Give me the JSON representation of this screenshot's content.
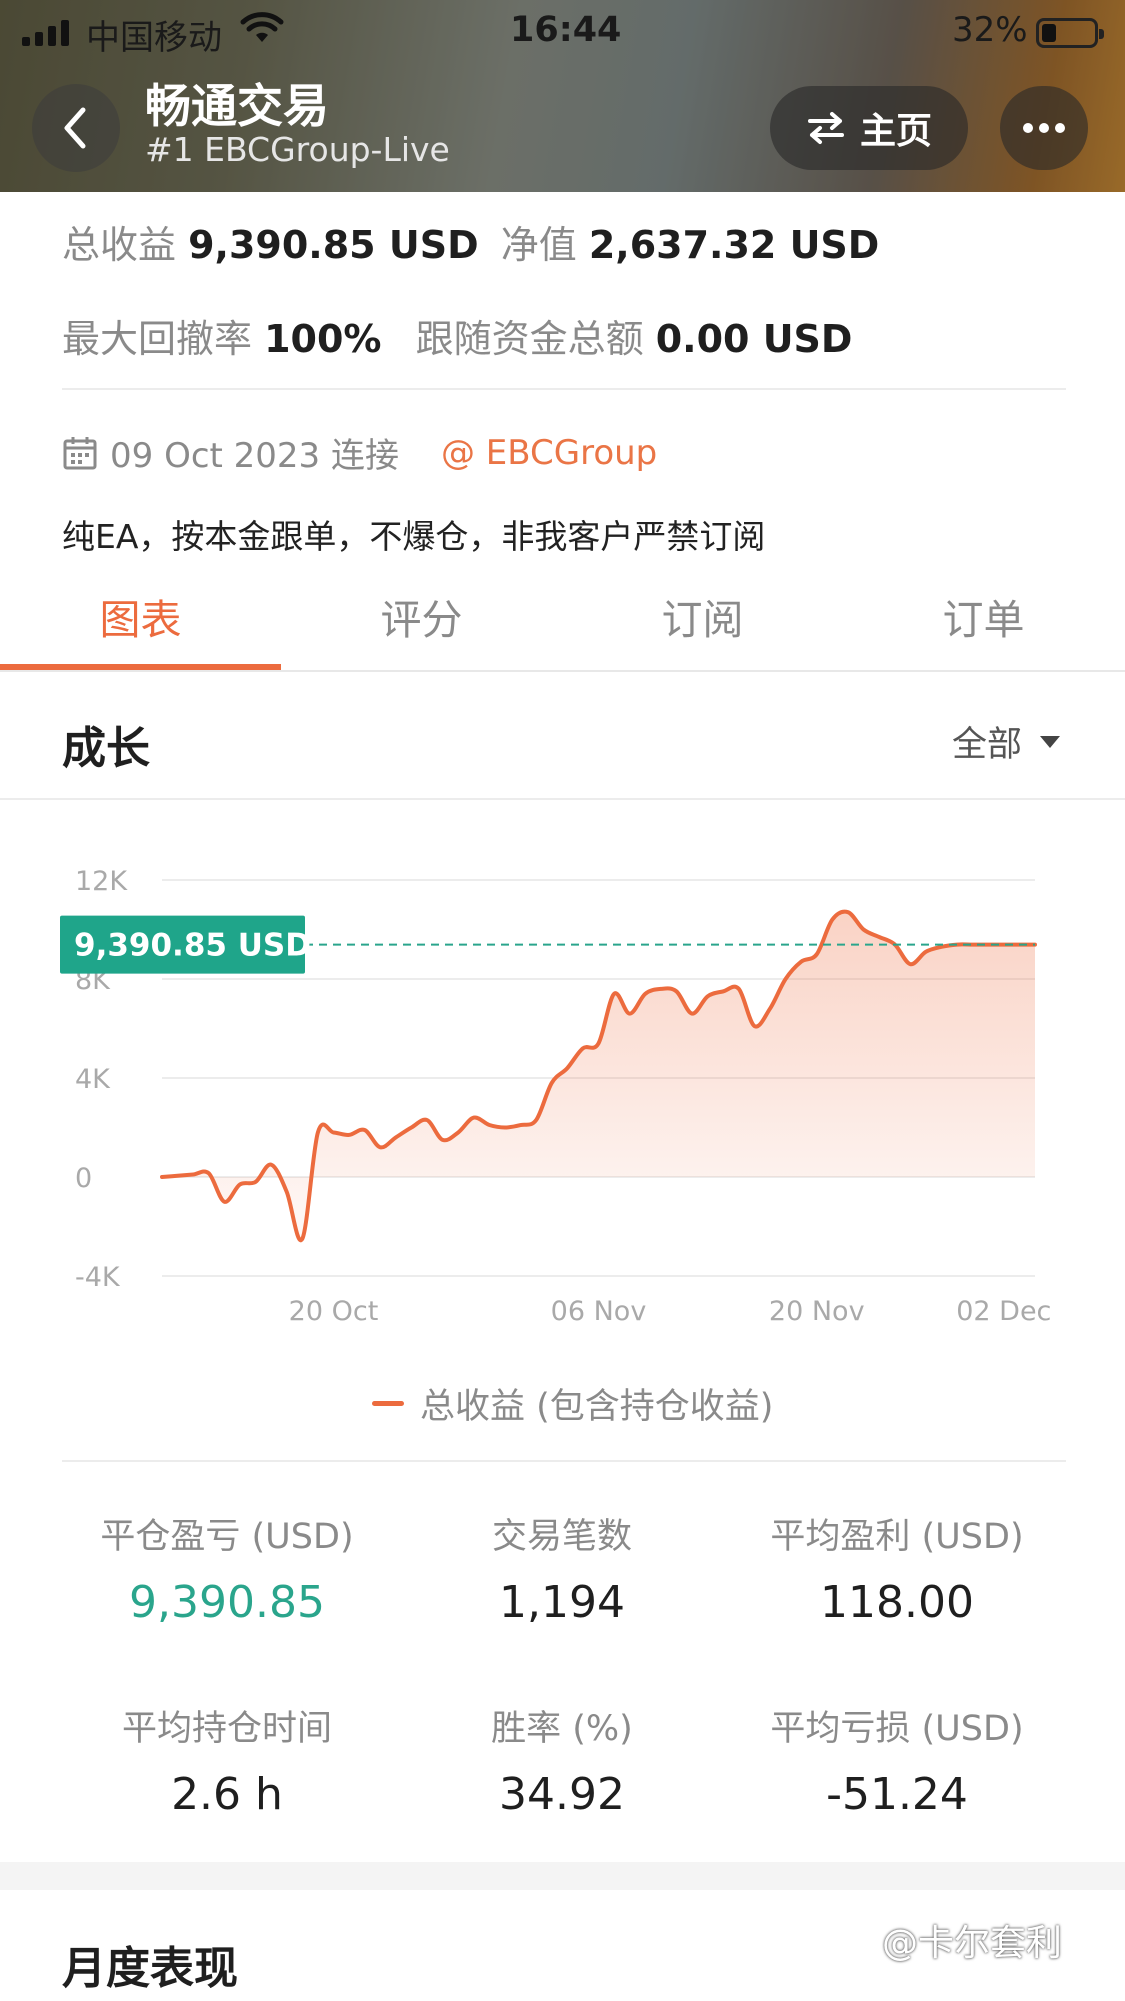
{
  "status_bar": {
    "carrier": "中国移动",
    "time": "16:44",
    "battery": "32%"
  },
  "header": {
    "title": "畅通交易",
    "subtitle": "#1 EBCGroup-Live",
    "home_label": "主页"
  },
  "summary": {
    "total_profit_label": "总收益",
    "total_profit_value": "9,390.85 USD",
    "equity_label": "净值",
    "equity_value": "2,637.32 USD",
    "max_drawdown_label": "最大回撤率",
    "max_drawdown_value": "100%",
    "follow_funds_label": "跟随资金总额",
    "follow_funds_value": "0.00 USD"
  },
  "connection": {
    "date_text": "09 Oct 2023 连接",
    "provider": "@ EBCGroup"
  },
  "description": "纯EA，按本金跟单，不爆仓，非我客户严禁订阅",
  "tabs": [
    {
      "label": "图表",
      "active": true
    },
    {
      "label": "评分",
      "active": false
    },
    {
      "label": "订阅",
      "active": false
    },
    {
      "label": "订单",
      "active": false
    }
  ],
  "growth": {
    "title": "成长",
    "range_label": "全部"
  },
  "chart_data": {
    "type": "area",
    "title": "",
    "y_ticks": [
      "12K",
      "8K",
      "4K",
      "0",
      "-4K"
    ],
    "ylim": [
      -4000,
      12000
    ],
    "x_tick_labels": [
      "20 Oct",
      "06 Nov",
      "20 Nov",
      "02 Dec"
    ],
    "current_value_label": "9,390.85 USD",
    "current_value": 9390.85,
    "series": [
      {
        "name": "总收益 (包含持仓收益)",
        "color": "#ec6b3e",
        "x": [
          "09 Oct",
          "10 Oct",
          "11 Oct",
          "12 Oct",
          "13 Oct",
          "14 Oct",
          "15 Oct",
          "16 Oct",
          "17 Oct",
          "18 Oct",
          "19 Oct",
          "20 Oct",
          "21 Oct",
          "22 Oct",
          "23 Oct",
          "24 Oct",
          "25 Oct",
          "26 Oct",
          "27 Oct",
          "28 Oct",
          "29 Oct",
          "30 Oct",
          "31 Oct",
          "01 Nov",
          "02 Nov",
          "03 Nov",
          "04 Nov",
          "05 Nov",
          "06 Nov",
          "07 Nov",
          "08 Nov",
          "09 Nov",
          "10 Nov",
          "11 Nov",
          "12 Nov",
          "13 Nov",
          "14 Nov",
          "15 Nov",
          "16 Nov",
          "17 Nov",
          "18 Nov",
          "19 Nov",
          "20 Nov",
          "21 Nov",
          "22 Nov",
          "23 Nov",
          "24 Nov",
          "25 Nov",
          "26 Nov",
          "27 Nov",
          "28 Nov",
          "29 Nov",
          "30 Nov",
          "01 Dec",
          "02 Dec",
          "03 Dec",
          "04 Dec"
        ],
        "values": [
          0,
          50,
          100,
          150,
          -1000,
          -300,
          -200,
          500,
          -600,
          -2500,
          1800,
          1800,
          1700,
          1900,
          1200,
          1600,
          2000,
          2300,
          1500,
          1800,
          2400,
          2100,
          2000,
          2100,
          2300,
          3800,
          4400,
          5200,
          5400,
          7400,
          6600,
          7400,
          7600,
          7500,
          6600,
          7300,
          7500,
          7600,
          6100,
          6800,
          8000,
          8700,
          9000,
          10400,
          10700,
          10000,
          9700,
          9400,
          8600,
          9100,
          9300,
          9390.85,
          9390.85,
          9390.85,
          9390.85,
          9390.85,
          9390.85
        ]
      }
    ]
  },
  "stats": [
    {
      "label": "平仓盈亏 (USD)",
      "value": "9,390.85"
    },
    {
      "label": "交易笔数",
      "value": "1,194"
    },
    {
      "label": "平均盈利 (USD)",
      "value": "118.00"
    },
    {
      "label": "平均持仓时间",
      "value": "2.6 h"
    },
    {
      "label": "胜率 (%)",
      "value": "34.92"
    },
    {
      "label": "平均亏损 (USD)",
      "value": "-51.24"
    }
  ],
  "monthly": {
    "title": "月度表现"
  },
  "watermark": "@卡尔套利"
}
